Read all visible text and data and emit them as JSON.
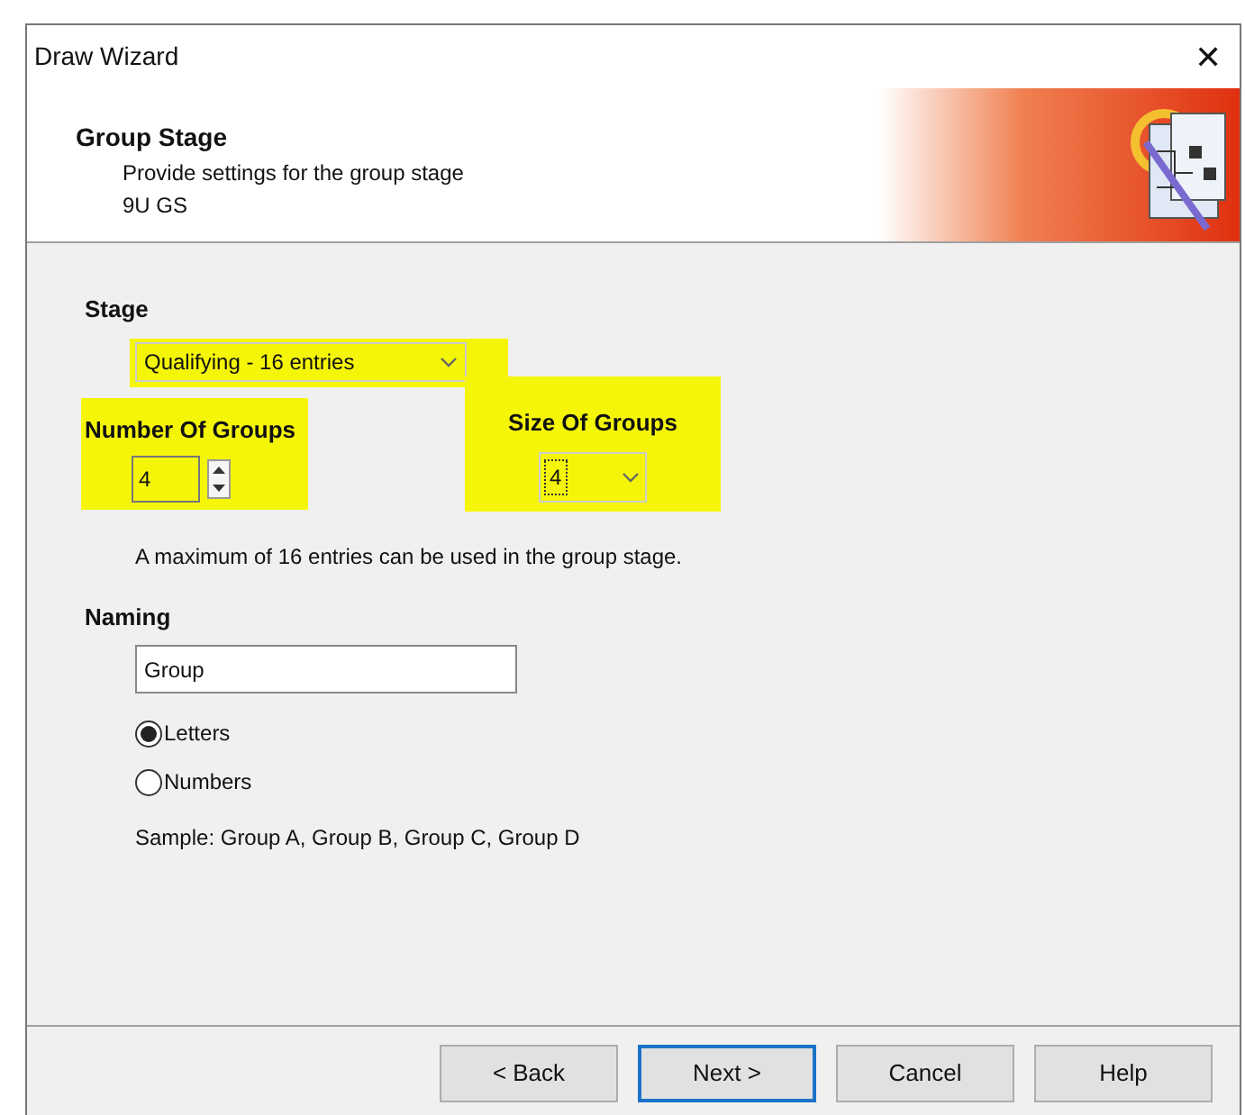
{
  "window": {
    "title": "Draw Wizard",
    "close": "✕"
  },
  "header": {
    "title": "Group Stage",
    "subtitle": "Provide settings for the group stage",
    "detail": "9U GS"
  },
  "stage": {
    "label": "Stage",
    "value": "Qualifying - 16 entries",
    "highlighted": true
  },
  "number_of_groups": {
    "label": "Number Of Groups",
    "value": "4",
    "highlighted": true
  },
  "size_of_groups": {
    "label": "Size Of Groups",
    "value": "4",
    "highlighted": true,
    "focused": true
  },
  "info": "A maximum of 16 entries can be used in the group stage.",
  "naming": {
    "label": "Naming",
    "value": "Group",
    "options": [
      {
        "label": "Letters",
        "selected": true
      },
      {
        "label": "Numbers",
        "selected": false
      }
    ],
    "sample": "Sample: Group A, Group B, Group C, Group D"
  },
  "buttons": [
    {
      "label": "< Back",
      "default": false
    },
    {
      "label": "Next >",
      "default": true
    },
    {
      "label": "Cancel",
      "default": false
    },
    {
      "label": "Help",
      "default": false
    }
  ]
}
